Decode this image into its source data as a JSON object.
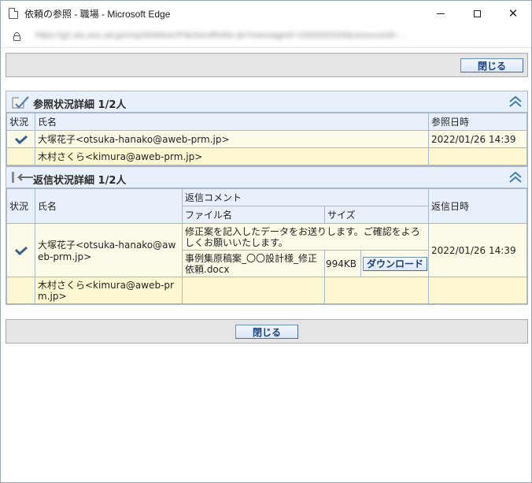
{
  "window": {
    "title": "依頼の参照 - 職場 - Microsoft Edge",
    "url": "https://g2.ats.aos.ad.jp/xmp/d/deliver/FileSendRefer.do?messageId=1000000528&resourceId=..."
  },
  "buttons": {
    "close_label": "閉じる",
    "download_label": "ダウンロード"
  },
  "reference_section": {
    "title": "参照状況詳細 1/2人",
    "headers": {
      "status": "状況",
      "name": "氏名",
      "date": "参照日時"
    },
    "rows": [
      {
        "name": "大塚花子<otsuka-hanako@aweb-prm.jp>",
        "date": "2022/01/26 14:39",
        "checked": true
      },
      {
        "name": "木村さくら<kimura@aweb-prm.jp>",
        "date": "",
        "checked": false
      }
    ]
  },
  "reply_section": {
    "title": "返信状況詳細 1/2人",
    "headers": {
      "status": "状況",
      "name": "氏名",
      "comment": "返信コメント",
      "file_name": "ファイル名",
      "size": "サイズ",
      "date": "返信日時"
    },
    "rows": [
      {
        "name": "大塚花子<otsuka-hanako@aweb-prm.jp>",
        "comment": "修正案を記入したデータをお送りします。ご確認をよろしくお願いいたします。",
        "file_name": "事例集原稿案_〇〇設計様_修正依頼.docx",
        "size": "994KB",
        "date": "2022/01/26 14:39",
        "checked": true
      },
      {
        "name": "木村さくら<kimura@aweb-prm.jp>",
        "comment": "",
        "file_name": "",
        "size": "",
        "date": "",
        "checked": false
      }
    ]
  },
  "colors": {
    "header_bg": "#e8f0fb",
    "row_bg": "#fdfbe7",
    "row_alt_bg": "#fdf7d2",
    "button_text": "#1a3f7a",
    "check": "#3a5f86"
  }
}
